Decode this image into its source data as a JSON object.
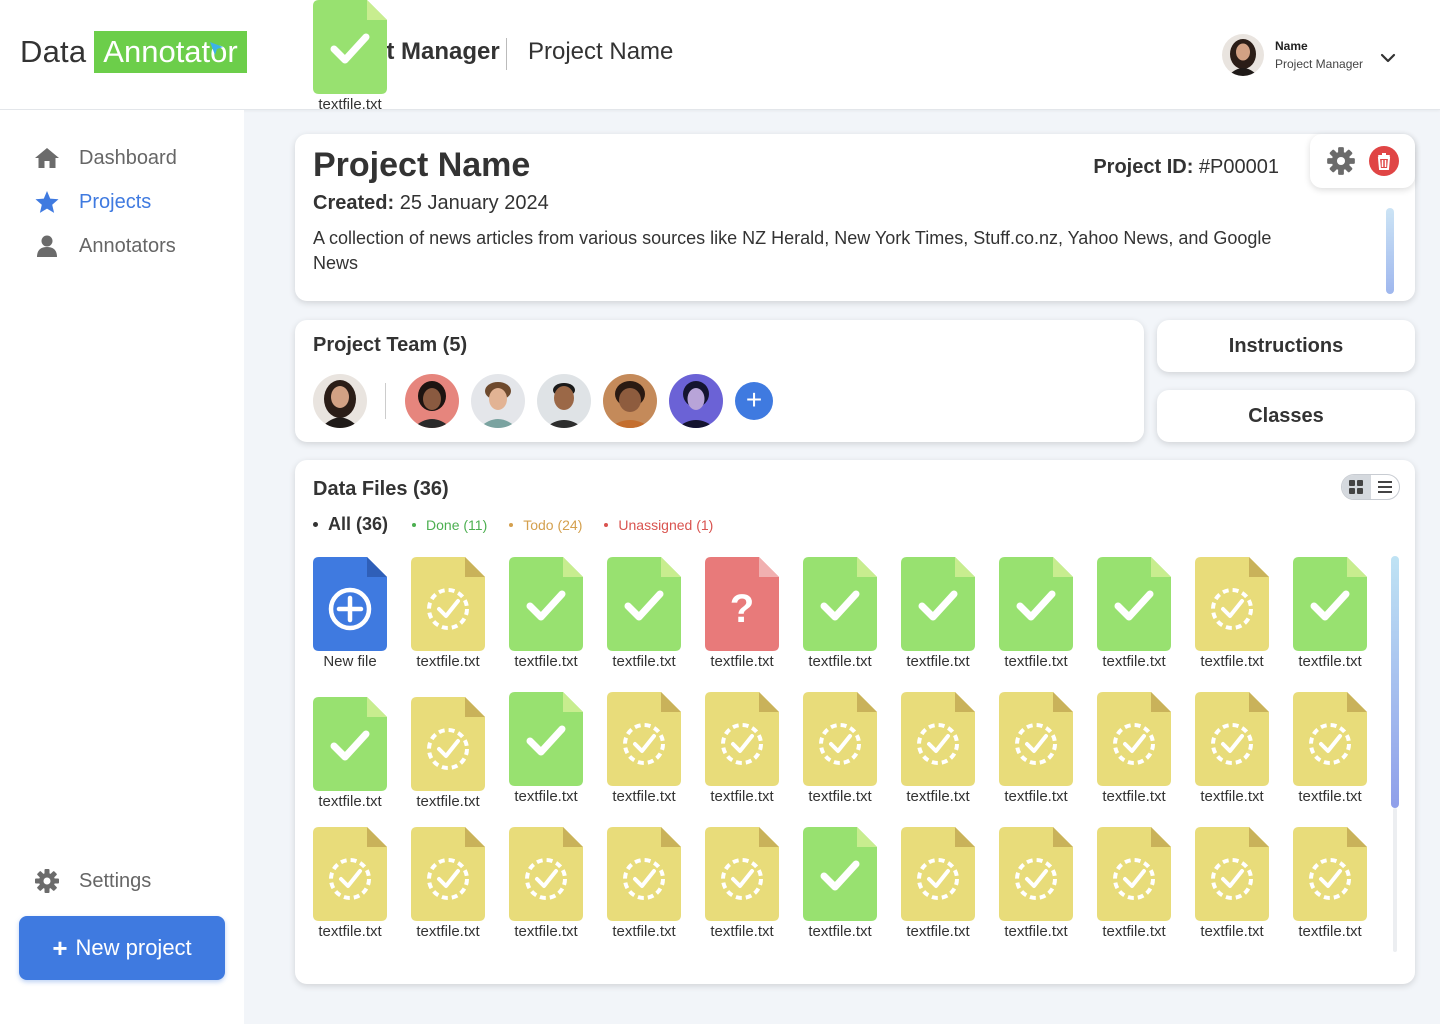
{
  "brand": {
    "part1": "Data",
    "part2": "Annotator"
  },
  "header": {
    "section": "Project Manager",
    "project": "Project Name"
  },
  "user": {
    "name": "Name",
    "role": "Project Manager"
  },
  "sidebar": {
    "items": [
      {
        "label": "Dashboard",
        "icon": "home-icon"
      },
      {
        "label": "Projects",
        "icon": "star-icon"
      },
      {
        "label": "Annotators",
        "icon": "user-icon"
      }
    ],
    "settings": "Settings",
    "new_project": "New project"
  },
  "project": {
    "title": "Project Name",
    "id_label": "Project ID:",
    "id_value": "#P00001",
    "created_label": "Created:",
    "created_value": "25 January 2024",
    "description": "A collection of news articles from various sources like NZ Herald, New York Times, Stuff.co.nz, Yahoo News, and Google News"
  },
  "team": {
    "title": "Project Team (5)"
  },
  "buttons": {
    "instructions": "Instructions",
    "classes": "Classes"
  },
  "files": {
    "title": "Data Files (36)",
    "filters": [
      {
        "label": "All (36)",
        "color": "#333333"
      },
      {
        "label": "Done (11)",
        "color": "#4caf50"
      },
      {
        "label": "Todo (24)",
        "color": "#d4a04e"
      },
      {
        "label": "Unassigned (1)",
        "color": "#d9534f"
      }
    ],
    "new_file_label": "New file",
    "items": [
      {
        "name": "textfile.txt",
        "status": "todo"
      },
      {
        "name": "textfile.txt",
        "status": "done"
      },
      {
        "name": "textfile.txt",
        "status": "done"
      },
      {
        "name": "textfile.txt",
        "status": "unassigned"
      },
      {
        "name": "textfile.txt",
        "status": "done"
      },
      {
        "name": "textfile.txt",
        "status": "done"
      },
      {
        "name": "textfile.txt",
        "status": "done"
      },
      {
        "name": "textfile.txt",
        "status": "done"
      },
      {
        "name": "textfile.txt",
        "status": "todo"
      },
      {
        "name": "textfile.txt",
        "status": "done"
      },
      {
        "name": "textfile.txt",
        "status": "done"
      },
      {
        "name": "textfile.txt",
        "status": "todo"
      },
      {
        "name": "textfile.txt",
        "status": "done"
      },
      {
        "name": "textfile.txt",
        "status": "todo"
      },
      {
        "name": "textfile.txt",
        "status": "todo"
      },
      {
        "name": "textfile.txt",
        "status": "todo"
      },
      {
        "name": "textfile.txt",
        "status": "todo"
      },
      {
        "name": "textfile.txt",
        "status": "todo"
      },
      {
        "name": "textfile.txt",
        "status": "todo"
      },
      {
        "name": "textfile.txt",
        "status": "todo"
      },
      {
        "name": "textfile.txt",
        "status": "todo"
      },
      {
        "name": "textfile.txt",
        "status": "todo"
      },
      {
        "name": "textfile.txt",
        "status": "todo"
      },
      {
        "name": "textfile.txt",
        "status": "todo"
      },
      {
        "name": "textfile.txt",
        "status": "todo"
      },
      {
        "name": "textfile.txt",
        "status": "todo"
      },
      {
        "name": "textfile.txt",
        "status": "done"
      },
      {
        "name": "textfile.txt",
        "status": "todo"
      },
      {
        "name": "textfile.txt",
        "status": "todo"
      },
      {
        "name": "textfile.txt",
        "status": "todo"
      },
      {
        "name": "textfile.txt",
        "status": "todo"
      },
      {
        "name": "textfile.txt",
        "status": "todo"
      },
      {
        "name": "textfile.txt",
        "status": "done"
      }
    ]
  },
  "colors": {
    "accent": "#3f7ae0",
    "brand_green": "#6cce4a",
    "done": "#98e170",
    "todo": "#e8dc7a",
    "unassigned": "#e87a7a",
    "delete": "#e04545"
  }
}
